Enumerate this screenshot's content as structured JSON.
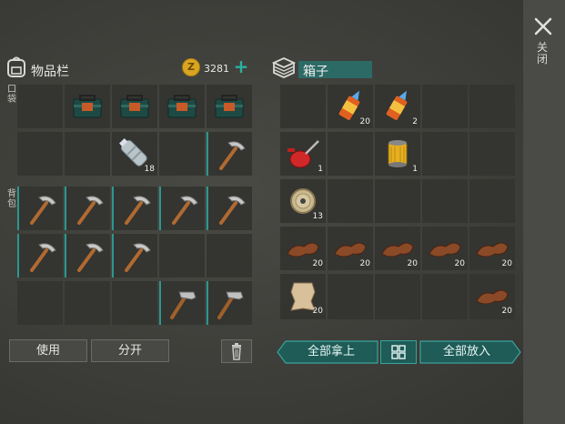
{
  "header": {
    "inventory_title": "物品栏",
    "coins": "3281",
    "coin_symbol": "Z",
    "box_title": "箱子"
  },
  "close": {
    "label": "关闭"
  },
  "side_labels": {
    "pocket": "口袋",
    "backpack": "背包"
  },
  "inventory": {
    "pocket": [
      {
        "item": "empty"
      },
      {
        "item": "toolbox-icon"
      },
      {
        "item": "toolbox-icon"
      },
      {
        "item": "toolbox-icon"
      },
      {
        "item": "toolbox-icon"
      },
      {
        "item": "empty"
      },
      {
        "item": "empty"
      },
      {
        "item": "bottle-icon",
        "count": "18"
      },
      {
        "item": "empty"
      },
      {
        "item": "pickaxe-icon",
        "hl": true
      }
    ],
    "backpack": [
      {
        "item": "pickaxe-icon",
        "hl": true
      },
      {
        "item": "pickaxe-icon",
        "hl": true
      },
      {
        "item": "pickaxe-icon",
        "hl": true
      },
      {
        "item": "pickaxe-icon",
        "hl": true
      },
      {
        "item": "pickaxe-icon",
        "hl": true
      },
      {
        "item": "pickaxe-icon",
        "hl": true
      },
      {
        "item": "pickaxe-icon",
        "hl": true
      },
      {
        "item": "pickaxe-icon",
        "hl": true
      },
      {
        "item": "empty"
      },
      {
        "item": "empty"
      },
      {
        "item": "empty"
      },
      {
        "item": "empty"
      },
      {
        "item": "empty"
      },
      {
        "item": "hammer-icon",
        "hl": true
      },
      {
        "item": "hammer-icon",
        "hl": true
      }
    ]
  },
  "box": {
    "slots": [
      {
        "item": "empty"
      },
      {
        "item": "glue-icon",
        "count": "20"
      },
      {
        "item": "glue-icon",
        "count": "2"
      },
      {
        "item": "empty"
      },
      {
        "item": "empty"
      },
      {
        "item": "oil-can-icon",
        "count": "1"
      },
      {
        "item": "empty"
      },
      {
        "item": "filter-icon",
        "count": "1"
      },
      {
        "item": "empty"
      },
      {
        "item": "empty"
      },
      {
        "item": "wire-spool-icon",
        "count": "13"
      },
      {
        "item": "empty"
      },
      {
        "item": "empty"
      },
      {
        "item": "empty"
      },
      {
        "item": "empty"
      },
      {
        "item": "leather-icon",
        "count": "20"
      },
      {
        "item": "leather-icon",
        "count": "20"
      },
      {
        "item": "leather-icon",
        "count": "20"
      },
      {
        "item": "leather-icon",
        "count": "20"
      },
      {
        "item": "leather-icon",
        "count": "20"
      },
      {
        "item": "hide-icon",
        "count": "20"
      },
      {
        "item": "empty"
      },
      {
        "item": "empty"
      },
      {
        "item": "empty"
      },
      {
        "item": "leather-icon",
        "count": "20"
      }
    ]
  },
  "buttons": {
    "use": "使用",
    "split": "分开",
    "take_all": "全部拿上",
    "put_all": "全部放入"
  },
  "colors": {
    "accent": "#2a9890",
    "button_teal": "#1f5b57"
  }
}
